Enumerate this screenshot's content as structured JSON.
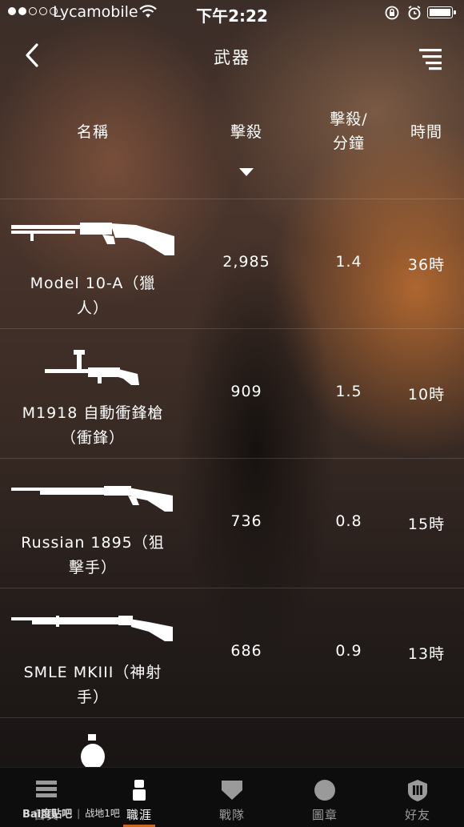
{
  "status_bar": {
    "carrier": "Lycamobile",
    "time": "下午2:22"
  },
  "nav": {
    "title": "武器"
  },
  "table": {
    "headers": {
      "name": "名稱",
      "kills": "擊殺",
      "kpm_line1": "擊殺/",
      "kpm_line2": "分鐘",
      "time": "時間"
    },
    "rows": [
      {
        "name_line1": "Model 10-A（獵",
        "name_line2": "人）",
        "kills": "2,985",
        "kpm": "1.4",
        "time": "36時",
        "icon": "shotgun-icon"
      },
      {
        "name_line1": "M1918 自動衝鋒槍",
        "name_line2": "（衝鋒）",
        "kills": "909",
        "kpm": "1.5",
        "time": "10時",
        "icon": "smg-icon"
      },
      {
        "name_line1": "Russian 1895（狙",
        "name_line2": "擊手）",
        "kills": "736",
        "kpm": "0.8",
        "time": "15時",
        "icon": "rifle-icon"
      },
      {
        "name_line1": "SMLE MKIII（神射",
        "name_line2": "手）",
        "kills": "686",
        "kpm": "0.9",
        "time": "13時",
        "icon": "rifle-icon"
      }
    ]
  },
  "tabs": [
    {
      "label": "首頁",
      "icon": "home-icon"
    },
    {
      "label": "職涯",
      "icon": "soldier-icon",
      "active": true
    },
    {
      "label": "戰隊",
      "icon": "shield-icon"
    },
    {
      "label": "圖章",
      "icon": "emblem-icon"
    },
    {
      "label": "好友",
      "icon": "friends-icon"
    }
  ],
  "watermark": {
    "logo": "Bai度贴吧",
    "text": "战地1吧"
  },
  "colors": {
    "accent": "#c9661e",
    "tabbar_bg": "#0d0d0d"
  }
}
